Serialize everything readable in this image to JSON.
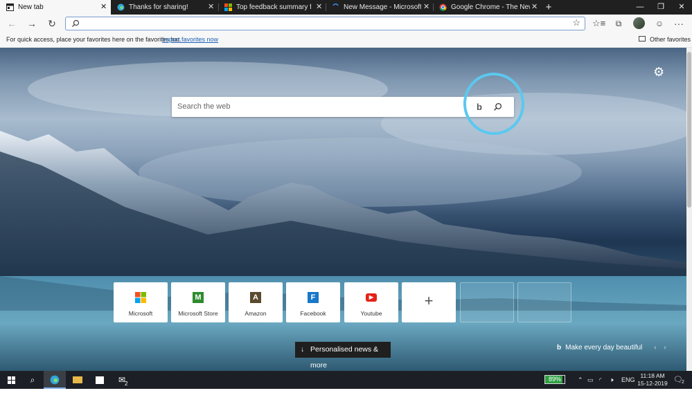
{
  "tabs": [
    {
      "title": "New tab",
      "active": true,
      "icon": "new-tab-icon"
    },
    {
      "title": "Thanks for sharing!",
      "icon": "edge-icon"
    },
    {
      "title": "Top feedback summary for Dece",
      "icon": "microsoft-logo-icon"
    },
    {
      "title": "New Message - Microsoft Tech C",
      "icon": "loading-spinner-icon"
    },
    {
      "title": "Google Chrome - The New Chro",
      "icon": "chrome-icon"
    }
  ],
  "addressbar": {
    "value": "",
    "placeholder": ""
  },
  "favorites_bar": {
    "message": "For quick access, place your favorites here on the favorites bar.",
    "import_link": "Import favorites now",
    "other_favorites": "Other favorites"
  },
  "search": {
    "placeholder": "Search the web"
  },
  "quick_links": [
    {
      "label": "Microsoft",
      "icon": "microsoft-logo-icon",
      "letter": ""
    },
    {
      "label": "Microsoft Store",
      "icon": "microsoft-store-icon",
      "letter": "M",
      "color": "#2e8b2e"
    },
    {
      "label": "Amazon",
      "icon": "amazon-icon",
      "letter": "A",
      "color": "#5a4a2e"
    },
    {
      "label": "Facebook",
      "icon": "facebook-icon",
      "letter": "F",
      "color": "#1877c9"
    },
    {
      "label": "Youtube",
      "icon": "youtube-icon",
      "letter": "▶",
      "color": "#e62117"
    }
  ],
  "news_button": "Personalised news & more",
  "tagline": "Make every day beautiful",
  "taskbar": {
    "battery": "89%",
    "language": "ENG",
    "time": "11:18 AM",
    "date": "15-12-2019",
    "mail_badge": "2",
    "notif_badge": "2"
  },
  "colors": {
    "highlight_circle": "#5bc8ef",
    "battery_fill": "#2ea043",
    "link": "#1a5fb4"
  }
}
